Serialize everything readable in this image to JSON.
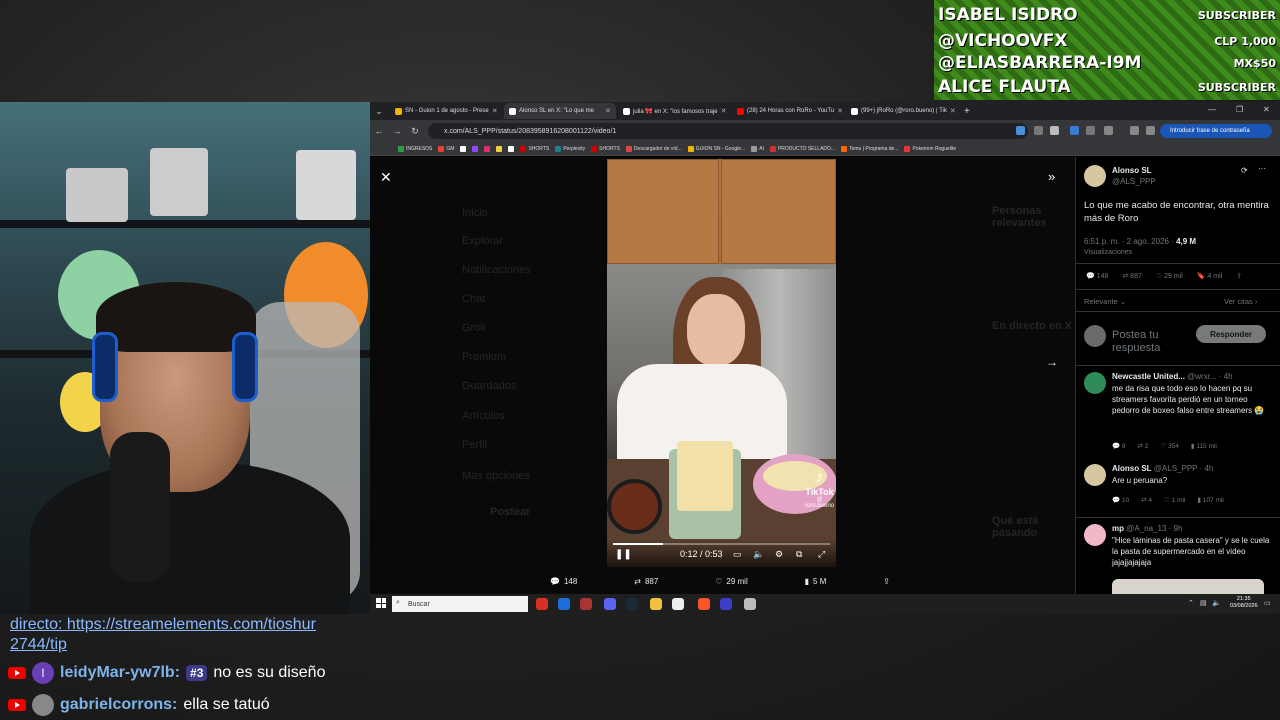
{
  "subscriber_panel": {
    "rows": [
      {
        "name": "ISABEL ISIDRO",
        "amount": "SUBSCRIBER"
      },
      {
        "name": "@VICHOOVFX",
        "amount": "CLP 1,000"
      },
      {
        "name": "@ELIASBARRERA-I9M",
        "amount": "MX$50"
      },
      {
        "name": "ALICE FLAUTA",
        "amount": "SUBSCRIBER"
      }
    ]
  },
  "chat": {
    "partial_line_1": "directo: https://streamelements.com/tioshur",
    "partial_line_2": "2744/tip",
    "messages": [
      {
        "user": "leidyMar-yw7lb:",
        "badge": "#3",
        "avatar_letter": "l",
        "avatar_color": "#6a3fb5",
        "text": "no es su diseño"
      },
      {
        "user": "gabrielcorrons:",
        "badge": "",
        "avatar_letter": "",
        "avatar_color": "#888888",
        "text": "ella se tatuó"
      }
    ]
  },
  "browser": {
    "tabs": [
      {
        "label": "SN - Guion 1 de agosto - Prese",
        "color": "#f4b400",
        "active": false
      },
      {
        "label": "Alonso SL en X: \"Lo que me",
        "color": "#ffffff",
        "active": true
      },
      {
        "label": "julia 🎀 en X: \"los famosos traje",
        "color": "#ffffff",
        "active": false
      },
      {
        "label": "(28) 24 Horas con RoRo - YouTu",
        "color": "#ff0000",
        "active": false
      },
      {
        "label": "(99+) jRoRo (@roro.bueno) | Tik",
        "color": "#ffffff",
        "active": false
      }
    ],
    "new_tab": "+",
    "url": "x.com/ALS_PPP/status/2083958916208001122/video/1",
    "password_button": "Introducir frase de contraseña",
    "bookmarks": [
      "INGRESOS",
      "GM",
      "SHORTS",
      "Perplexity",
      "SHORTS",
      "Descargador de víd...",
      "GUION SN - Google...",
      "AI",
      "PRODUCTO SELLADO...",
      "Temu | Programa de...",
      "Pokemon Roguelite"
    ]
  },
  "video": {
    "current_time": "0:12 / 0:53",
    "progress": 0.23,
    "watermark": "TikTok",
    "watermark_handle": "@ roro.bueno"
  },
  "engagement": {
    "replies": "148",
    "reposts": "887",
    "likes": "29 mil",
    "views": "5 M"
  },
  "tweet": {
    "author_name": "Alonso SL",
    "author_handle": "@ALS_PPP",
    "text": "Lo que me acabo de encontrar, otra mentira más de Roro",
    "timestamp": "6:51 p. m. · 2 ago. 2026 ·",
    "views_count": "4,9 M",
    "views_label": "Visualizaciones",
    "stats": {
      "replies": "148",
      "reposts": "887",
      "likes": "29 mil",
      "bookmarks": "4 mil"
    },
    "sort_label": "Relevante",
    "quotes_label": "Ver citas",
    "reply_placeholder": "Postea tu respuesta",
    "reply_button": "Responder"
  },
  "replies": [
    {
      "name": "Newcastle United...",
      "handle": "@wrxr... · 4h",
      "text": "me da risa que todo eso lo hacen pq su streamers favorita perdió en un torneo pedorro de boxeo falso entre streamers 😭",
      "replies": "9",
      "reposts": "2",
      "likes": "354",
      "views": "115 mil"
    },
    {
      "name": "Alonso SL",
      "handle": "@ALS_PPP · 4h",
      "text": "Are u peruana?",
      "replies": "10",
      "reposts": "4",
      "likes": "1 mil",
      "views": "107 mil"
    },
    {
      "name": "mp",
      "handle": "@A_na_13 · 9h",
      "text": "\"Hice láminas de pasta casera\" y se le cuela la pasta de supermercado en el video jajajjajajaja",
      "replies": "",
      "reposts": "",
      "likes": "",
      "views": ""
    }
  ],
  "ghost_sidebar": [
    "Inicio",
    "Explorar",
    "Notificaciones",
    "Chat",
    "Grok",
    "Premium",
    "Guardados",
    "Artículos",
    "Perfil",
    "Más opciones"
  ],
  "ghost_post_button": "Postear",
  "ghost_right": [
    "Personas relevantes",
    "En directo en X",
    "Qué está pasando"
  ],
  "taskbar": {
    "search_placeholder": "Buscar",
    "time": "21:35",
    "date": "03/08/2026"
  }
}
